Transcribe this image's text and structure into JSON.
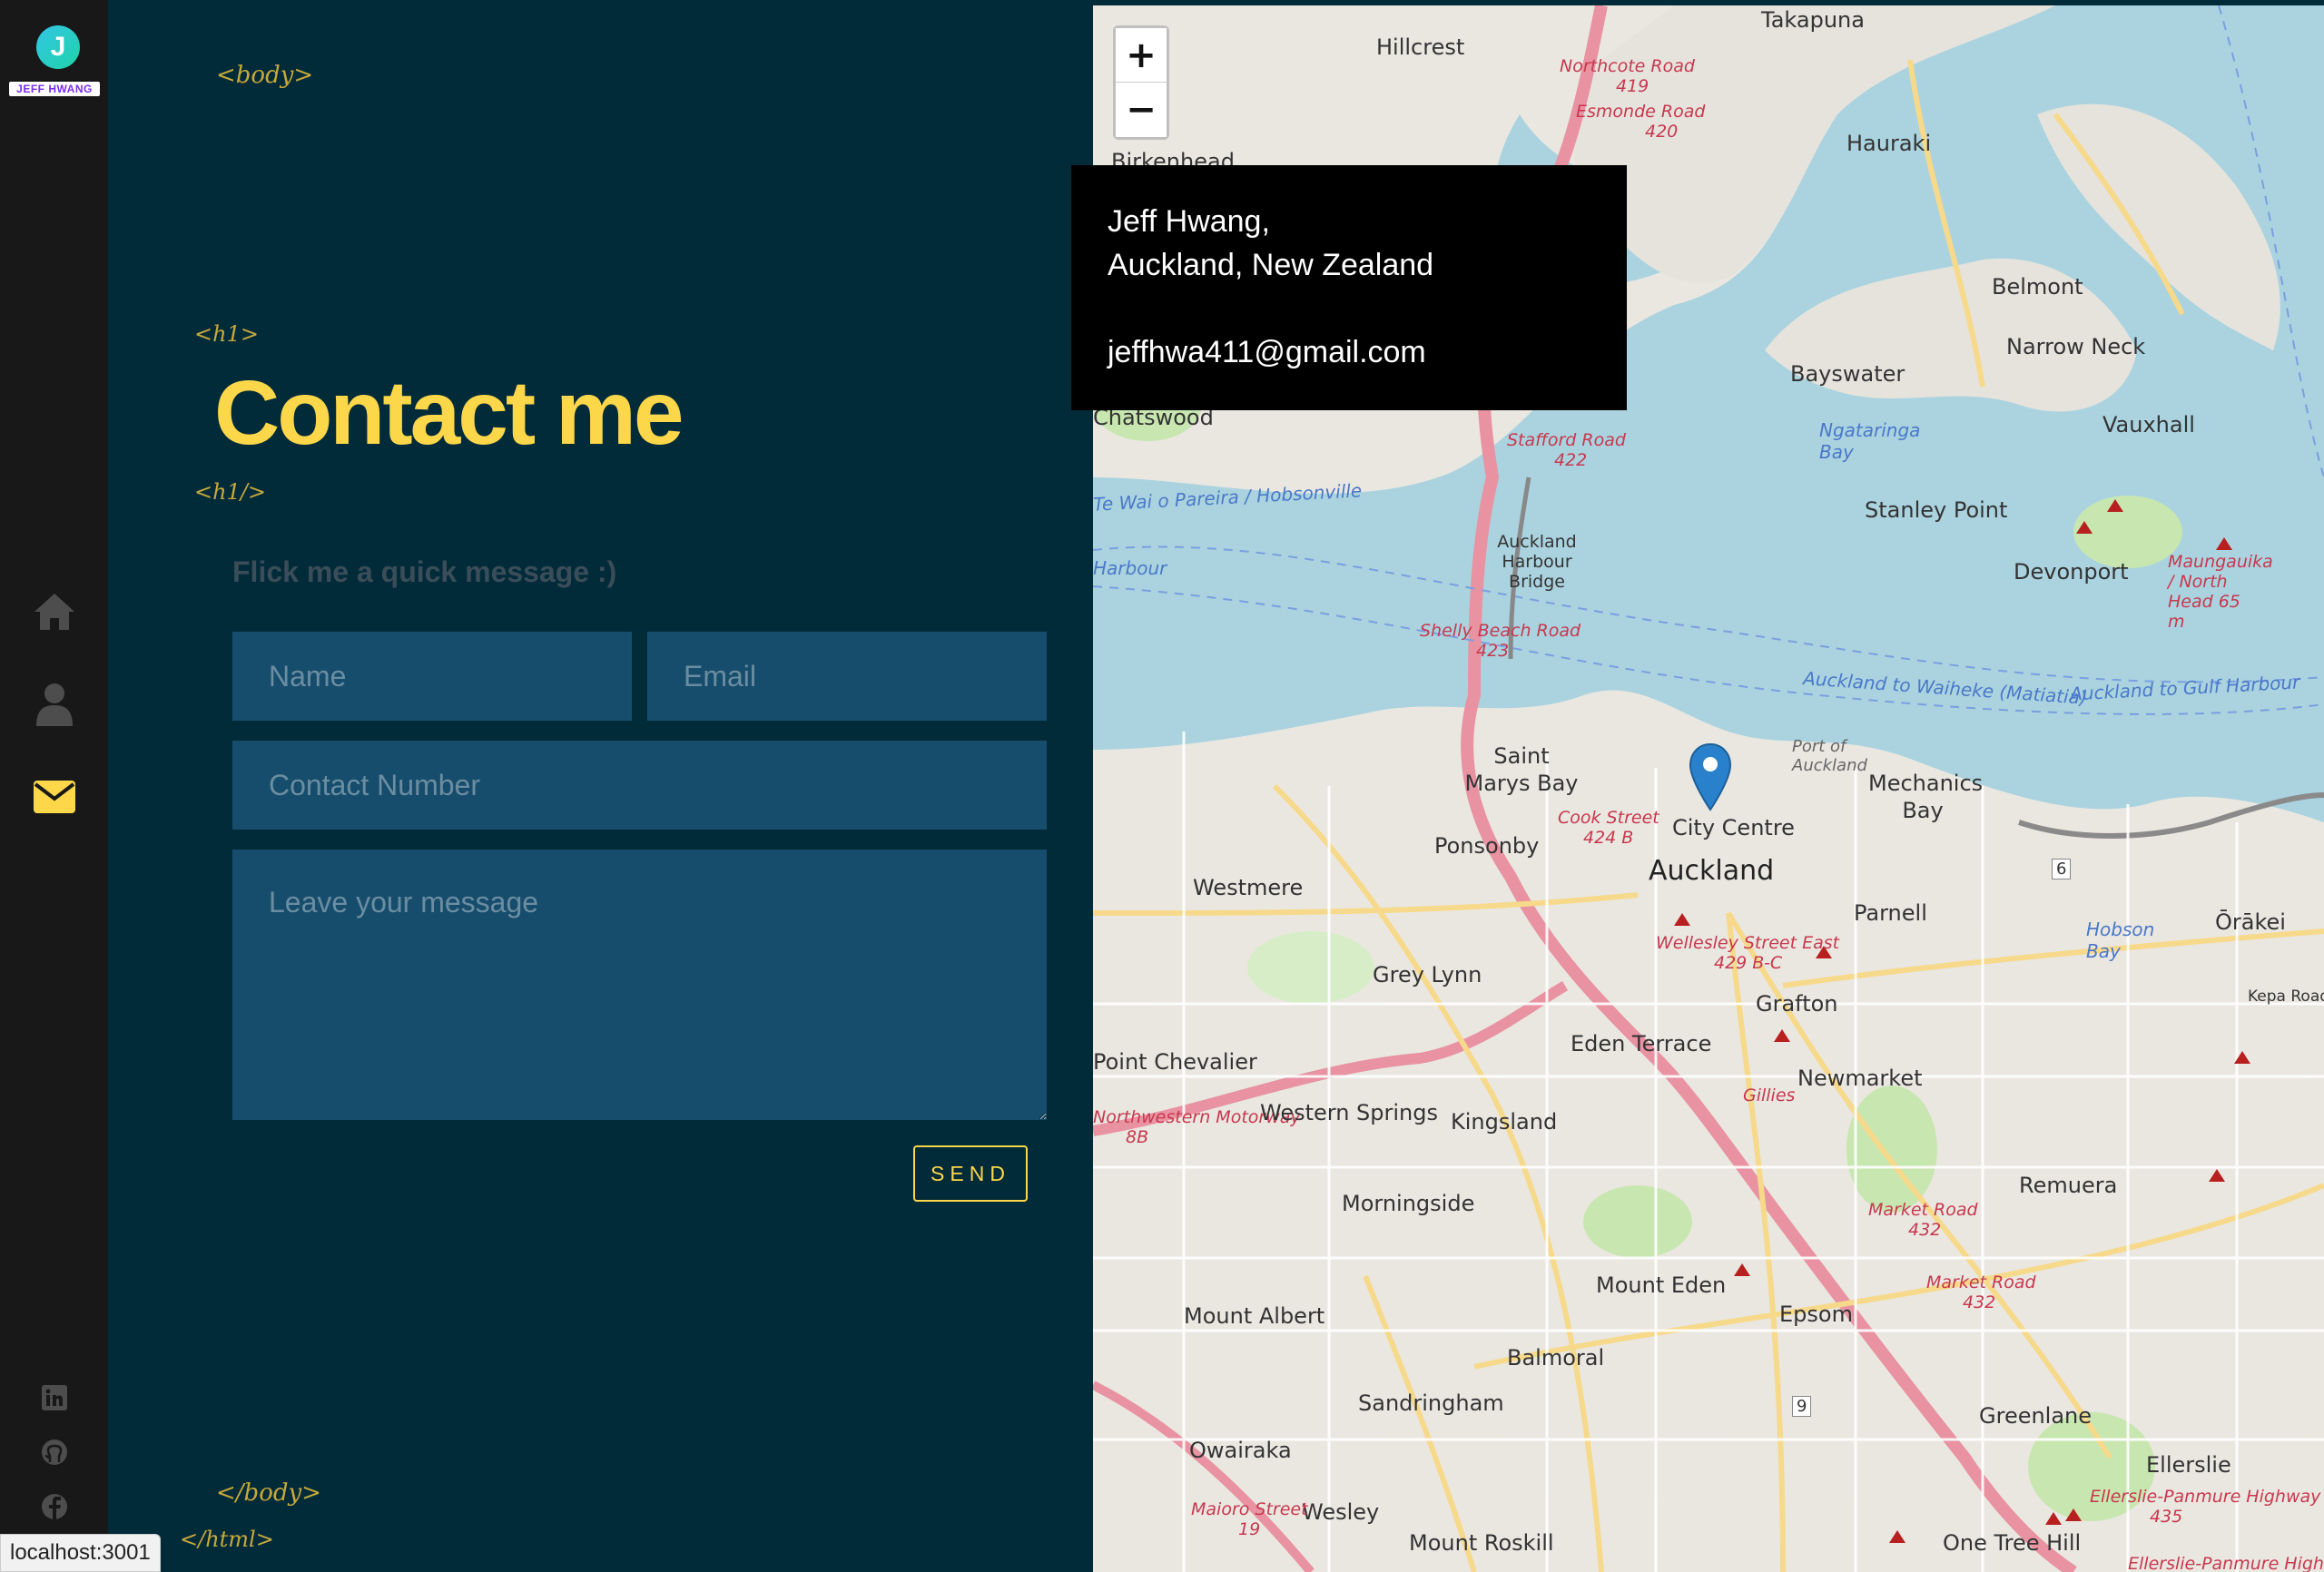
{
  "sidebar": {
    "logo_letter": "J",
    "logo_text": "JEFF HWANG",
    "nav": [
      {
        "name": "home-icon",
        "active": false
      },
      {
        "name": "user-icon",
        "active": false
      },
      {
        "name": "envelope-icon",
        "active": true
      }
    ],
    "social": [
      "linkedin-icon",
      "github-icon",
      "facebook-icon"
    ]
  },
  "tags": {
    "body_open": "<body>",
    "h1_open": "<h1>",
    "h1_close": "<h1/>",
    "body_close": "</body>",
    "html_close": "</html>"
  },
  "contact": {
    "title": "Contact me",
    "subtitle": "Flick me a quick message :)",
    "name_placeholder": "Name",
    "email_placeholder": "Email",
    "phone_placeholder": "Contact Number",
    "message_placeholder": "Leave your message",
    "send_label": "SEND"
  },
  "map": {
    "zoom_in": "+",
    "zoom_out": "−",
    "popup_name": "Jeff Hwang,",
    "popup_location": "Auckland, New Zealand",
    "popup_email": "jeffhwa411@gmail.com",
    "labels": {
      "takapuna": "Takapuna",
      "hillcrest": "Hillcrest",
      "northcote_road": "Northcote Road",
      "road_419": "419",
      "esmonde_road": "Esmonde Road",
      "road_420": "420",
      "birkenhead": "Birkenhead",
      "hauraki": "Hauraki",
      "belmont": "Belmont",
      "bayswater": "Bayswater",
      "narrow_neck": "Narrow Neck",
      "chatswood": "Chatswood",
      "vauxhall": "Vauxhall",
      "stafford_road": "Stafford Road",
      "road_422": "422",
      "ngataringa_bay": "Ngataringa Bay",
      "stanley_point": "Stanley Point",
      "devonport": "Devonport",
      "maungauika": "Maungauika / North Head 65 m",
      "hobsonville": "Te Wai o Pareira / Hobsonville",
      "harbour": "Harbour",
      "harbour_bridge": "Auckland Harbour Bridge",
      "shelly_beach_road": "Shelly Beach Road",
      "road_423": "423",
      "waiheke": "Auckland to Waiheke (Matiatia)",
      "gulf_harbour": "Auckland to Gulf Harbour",
      "saint_marys_bay": "Saint Marys Bay",
      "port_of_auckland": "Port of Auckland",
      "mechanics_bay": "Mechanics Bay",
      "cook_street": "Cook Street",
      "road_424b": "424 B",
      "city_centre": "City Centre",
      "auckland": "Auckland",
      "ponsonby": "Ponsonby",
      "westmere": "Westmere",
      "parnell": "Parnell",
      "orakei": "Ōrākei",
      "hobson_bay": "Hobson Bay",
      "kepa_road": "Kepa Road",
      "wellesley_street": "Wellesley Street East",
      "road_429": "429 B-C",
      "grey_lynn": "Grey Lynn",
      "grafton": "Grafton",
      "point_chevalier": "Point Chevalier",
      "eden_terrace": "Eden Terrace",
      "newmarket": "Newmarket",
      "western_motorway": "Northwestern Motorway",
      "road_8b": "8B",
      "western_springs": "Western Springs",
      "kingsland": "Kingsland",
      "gillies": "Gillies",
      "remuera": "Remuera",
      "morningside": "Morningside",
      "market_road": "Market Road",
      "road_432": "432",
      "mount_eden": "Mount Eden",
      "mount_albert": "Mount Albert",
      "epsom": "Epsom",
      "balmoral": "Balmoral",
      "sandringham": "Sandringham",
      "greenlane": "Greenlane",
      "owairaka": "Owairaka",
      "ellerslie": "Ellerslie",
      "ellerslie_panmure": "Ellerslie-Panmure Highway",
      "road_435": "435",
      "mount_roskill": "Mount Roskill",
      "wesley": "Wesley",
      "one_tree_hill": "One Tree Hill",
      "maioro_street": "Maioro Street",
      "road_19": "19",
      "shield_6": "6",
      "shield_9": "9"
    }
  },
  "status_url": "localhost:3001"
}
